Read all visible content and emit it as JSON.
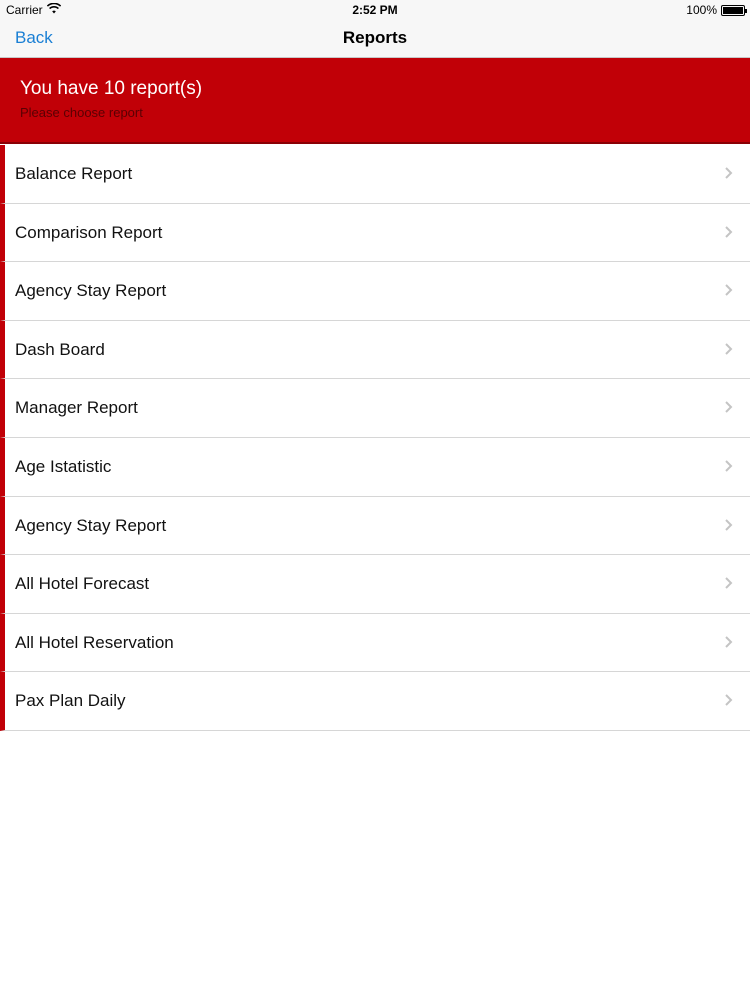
{
  "status_bar": {
    "carrier": "Carrier",
    "time": "2:52 PM",
    "battery_percent": "100%",
    "battery_level": 1.0
  },
  "nav": {
    "back_label": "Back",
    "title": "Reports"
  },
  "banner": {
    "title": "You have 10 report(s)",
    "subtitle": "Please choose report"
  },
  "reports": [
    {
      "label": "Balance Report"
    },
    {
      "label": "Comparison Report"
    },
    {
      "label": "Agency Stay Report"
    },
    {
      "label": "Dash Board"
    },
    {
      "label": "Manager Report"
    },
    {
      "label": "Age Istatistic"
    },
    {
      "label": "Agency Stay Report"
    },
    {
      "label": "All Hotel Forecast"
    },
    {
      "label": "All Hotel Reservation"
    },
    {
      "label": "Pax Plan Daily"
    }
  ],
  "icons": {
    "row_disclosure": "chevron-right-icon",
    "wifi": "wifi-icon",
    "battery": "battery-icon"
  },
  "colors": {
    "accent_red": "#c10007",
    "link_blue": "#1a7fd4"
  }
}
